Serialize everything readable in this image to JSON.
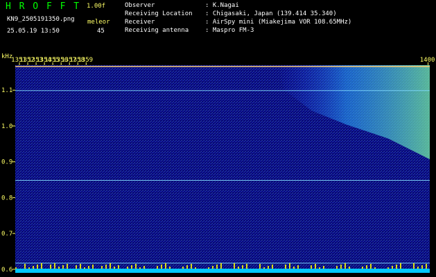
{
  "header": {
    "software": "H R O F F T",
    "version": "1.00f",
    "filename": "KN9_2505191350.png",
    "datetime": "25.05.19 13:50",
    "detector_label": "meleor",
    "detector_value": "45",
    "info": [
      {
        "label": "Observer",
        "value": ": K.Nagai"
      },
      {
        "label": "Receiving Location",
        "value": ": Chigasaki, Japan (139.414 35.340)"
      },
      {
        "label": "Receiver",
        "value": ": AirSpy mini (Miakejima VOR 108.65MHz)"
      },
      {
        "label": "Receiving antenna",
        "value": ": Maspro FM-3"
      }
    ]
  },
  "chart_data": {
    "type": "heatmap",
    "ylabel": "kHz",
    "x_ticks": [
      "1351",
      "1352",
      "1353",
      "1354",
      "1355",
      "1356",
      "1357",
      "1358",
      "1359",
      "1400"
    ],
    "y_ticks": [
      1.1,
      1.0,
      0.9,
      0.8,
      0.7,
      0.6
    ],
    "ylim": [
      0.59,
      1.17
    ],
    "xlim": [
      1350.5,
      1400.2
    ],
    "horizontal_lines_khz": [
      1.166,
      1.099,
      0.848,
      0.617
    ],
    "colors": {
      "background": "#0a0a78",
      "noise_low": "#1e3cff",
      "noise_high": "#64c8ff",
      "hot": "#ffff00",
      "line": "#7fd8ff",
      "tick_text": "#ffff66",
      "header_text": "#ffffff"
    }
  }
}
